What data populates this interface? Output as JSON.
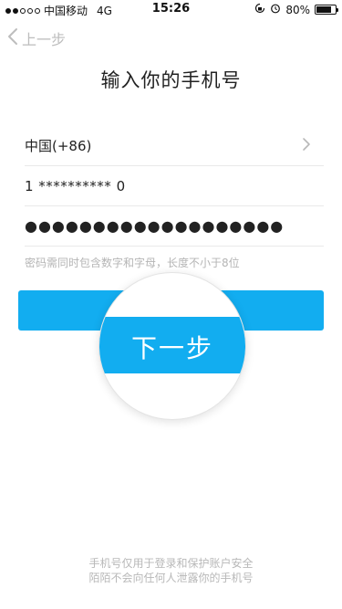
{
  "status_bar": {
    "carrier": "中国移动",
    "network": "4G",
    "time": "15:26",
    "battery": "80%",
    "battery_level": 0.8,
    "signal_bars_filled": 2,
    "signal_bars_total": 5
  },
  "nav": {
    "back_label": "上一步"
  },
  "page": {
    "title": "输入你的手机号"
  },
  "form": {
    "country": "中国(+86)",
    "phone": "1 ********** 0",
    "password": "●●●●●●●●●●●●●●●●●●●",
    "password_hint": "密码需同时包含数字和字母，长度不小于8位"
  },
  "next_button": {
    "label": "下一步"
  },
  "footer": {
    "line1": "手机号仅用于登录和保护账户安全",
    "line2": "陌陌不会向任何人泄露你的手机号"
  },
  "colors": {
    "accent": "#12adf0",
    "muted_text": "#b5b5b5",
    "divider": "#e9e9e9"
  },
  "icons": {
    "back": "chevron-left-icon",
    "country_arrow": "chevron-right-icon",
    "alarm": "alarm-icon",
    "rotation_lock": "rotation-lock-icon"
  }
}
